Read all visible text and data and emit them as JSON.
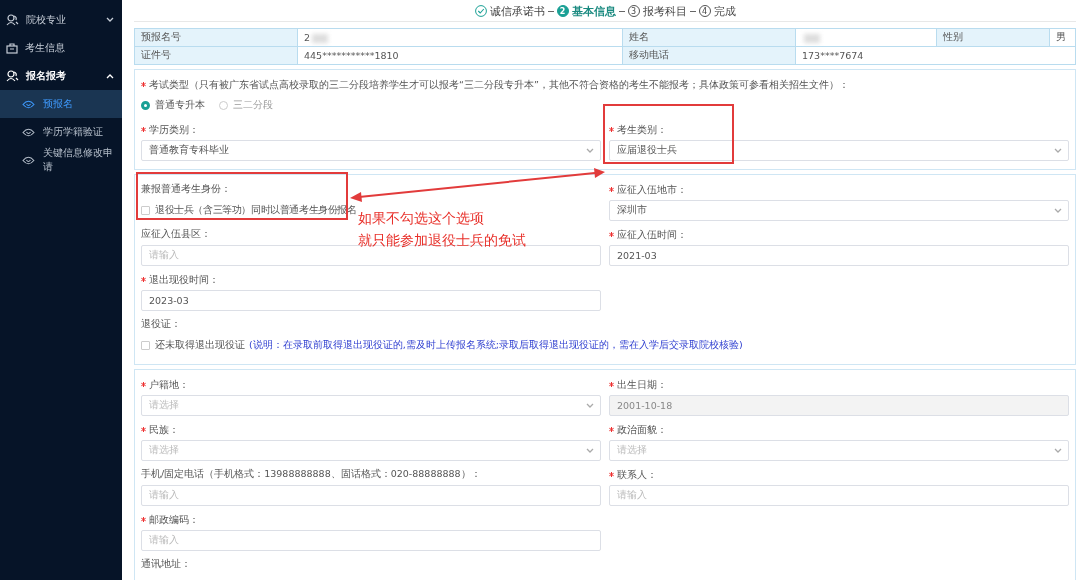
{
  "sidebar": {
    "items": [
      {
        "label": "院校专业",
        "expanded": false
      },
      {
        "label": "考生信息"
      },
      {
        "label": "报名报考",
        "expanded": true,
        "children": [
          {
            "label": "预报名",
            "selected": true
          },
          {
            "label": "学历学籍验证",
            "selected": false
          },
          {
            "label": "关键信息修改申请",
            "selected": false
          }
        ]
      }
    ]
  },
  "steps": [
    {
      "label": "诚信承诺书",
      "done": true,
      "selected": false
    },
    {
      "label": "基本信息",
      "number": "2",
      "done": false,
      "selected": true
    },
    {
      "label": "报考科目",
      "number": "3",
      "done": false,
      "selected": false
    },
    {
      "label": "完成",
      "number": "4",
      "done": false,
      "selected": false
    }
  ],
  "info_table": {
    "rows": [
      [
        {
          "kind": "label",
          "text": "预报名号"
        },
        {
          "kind": "value",
          "text": "2",
          "redacted": true
        },
        {
          "kind": "label",
          "text": "姓名"
        },
        {
          "kind": "value",
          "redacted": true
        },
        {
          "kind": "label",
          "text": "性别"
        },
        {
          "kind": "value",
          "text": "男"
        }
      ],
      [
        {
          "kind": "label",
          "text": "证件号"
        },
        {
          "kind": "value",
          "text": "445***********1810"
        },
        {
          "kind": "label",
          "text": "移动电话"
        },
        {
          "kind": "value",
          "text": "173****7674",
          "colspan": 3
        }
      ]
    ]
  },
  "sections": [
    {
      "fields": [
        {
          "kind": "radio",
          "label": "考试类型（只有被广东省试点高校录取的三二分段培养学生才可以报考“三二分段专升本”，其他不符合资格的考生不能报考；具体政策可参看相关招生文件）：",
          "required": true,
          "full_width": true,
          "options": [
            {
              "label": "普通专升本",
              "selected": true,
              "disabled": false
            },
            {
              "label": "三二分段",
              "selected": false,
              "disabled": true
            }
          ]
        },
        {
          "kind": "select",
          "label": "学历类别：",
          "required": true,
          "value": "普通教育专科毕业",
          "highlighted": false
        },
        {
          "kind": "select",
          "label": "考生类别：",
          "required": true,
          "value": "应届退役士兵",
          "highlighted": true
        }
      ]
    },
    {
      "fields": [
        {
          "kind": "checkbox",
          "label": "兼报普通考生身份：",
          "required": false,
          "highlighted": true,
          "options": [
            {
              "label": "退役士兵（含三等功）同时以普通考生身份报名",
              "checked": false
            }
          ]
        },
        {
          "kind": "select",
          "label": "应征入伍地市：",
          "required": true,
          "value": "深圳市"
        },
        {
          "kind": "input",
          "label": "应征入伍县区：",
          "required": false,
          "placeholder": "请输入"
        },
        {
          "kind": "input",
          "label": "应征入伍时间：",
          "required": true,
          "value": "2021-03"
        },
        {
          "kind": "input",
          "label": "退出现役时间：",
          "required": true,
          "value": "2023-03"
        },
        {
          "kind": "checkbox",
          "label": "退役证：",
          "required": false,
          "full_width": true,
          "options": [
            {
              "label": "还未取得退出现役证",
              "checked": false,
              "note": "(说明：在录取前取得退出现役证的,需及时上传报名系统;录取后取得退出现役证的，需在入学后交录取院校核验)"
            }
          ]
        }
      ]
    },
    {
      "fields": [
        {
          "kind": "select",
          "label": "户籍地：",
          "required": true,
          "placeholder": "请选择"
        },
        {
          "kind": "input",
          "label": "出生日期：",
          "required": true,
          "value": "2001-10-18",
          "disabled": true
        },
        {
          "kind": "select",
          "label": "民族：",
          "required": true,
          "placeholder": "请选择"
        },
        {
          "kind": "select",
          "label": "政治面貌：",
          "required": true,
          "placeholder": "请选择"
        },
        {
          "kind": "input",
          "label": "手机/固定电话（手机格式：13988888888、固话格式：020-88888888）：",
          "required": false,
          "placeholder": "请输入"
        },
        {
          "kind": "input",
          "label": "联系人：",
          "required": true,
          "placeholder": "请输入"
        },
        {
          "kind": "input",
          "label": "邮政编码：",
          "required": true,
          "placeholder": "请输入"
        },
        {
          "kind": "label",
          "label": "通讯地址：",
          "required": false
        }
      ]
    }
  ],
  "annotation": {
    "lines": [
      "如果不勾选这个选项",
      "就只能参加退役士兵的免试"
    ]
  }
}
